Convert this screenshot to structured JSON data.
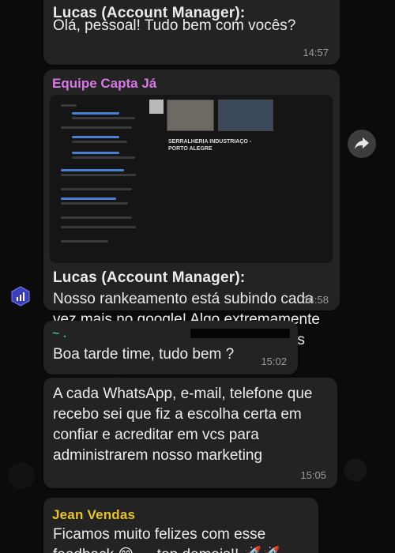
{
  "messages": [
    {
      "sender": "Lucas (Account Manager):",
      "text": "Olá, pessoal! Tudo bem com vocês?",
      "time": "14:57"
    },
    {
      "forwarded_from": "Equipe Capta Já",
      "preview_title": "SERRALHERIA INDUSTRIAÇO - PORTO ALEGRE",
      "sender": "Lucas (Account Manager):",
      "text": "Nosso rankeamento está subindo cada vez mais no google! Algo extremamente positivo para estarmos atingindo mais pessoas.",
      "time": "14:58"
    },
    {
      "sender": "~ .",
      "text": "Boa tarde time, tudo bem ?",
      "time": "15:02"
    },
    {
      "text": "A cada WhatsApp, e-mail, telefone que recebo sei que fiz a escolha certa em confiar e acreditar em vcs para administrarem nosso marketing",
      "time": "15:05"
    },
    {
      "sender": "Jean Vendas",
      "text": "Ficamos muito felizes com esse feedback 😊 … top demais!! 🚀🚀"
    }
  ],
  "colors": {
    "bubble": "#232323",
    "forwarded_team": "#d977e6",
    "jean_name": "#e6c330",
    "tilde_name": "#3bb08f"
  },
  "icons": [
    "forward-icon",
    "group-logo-icon"
  ]
}
